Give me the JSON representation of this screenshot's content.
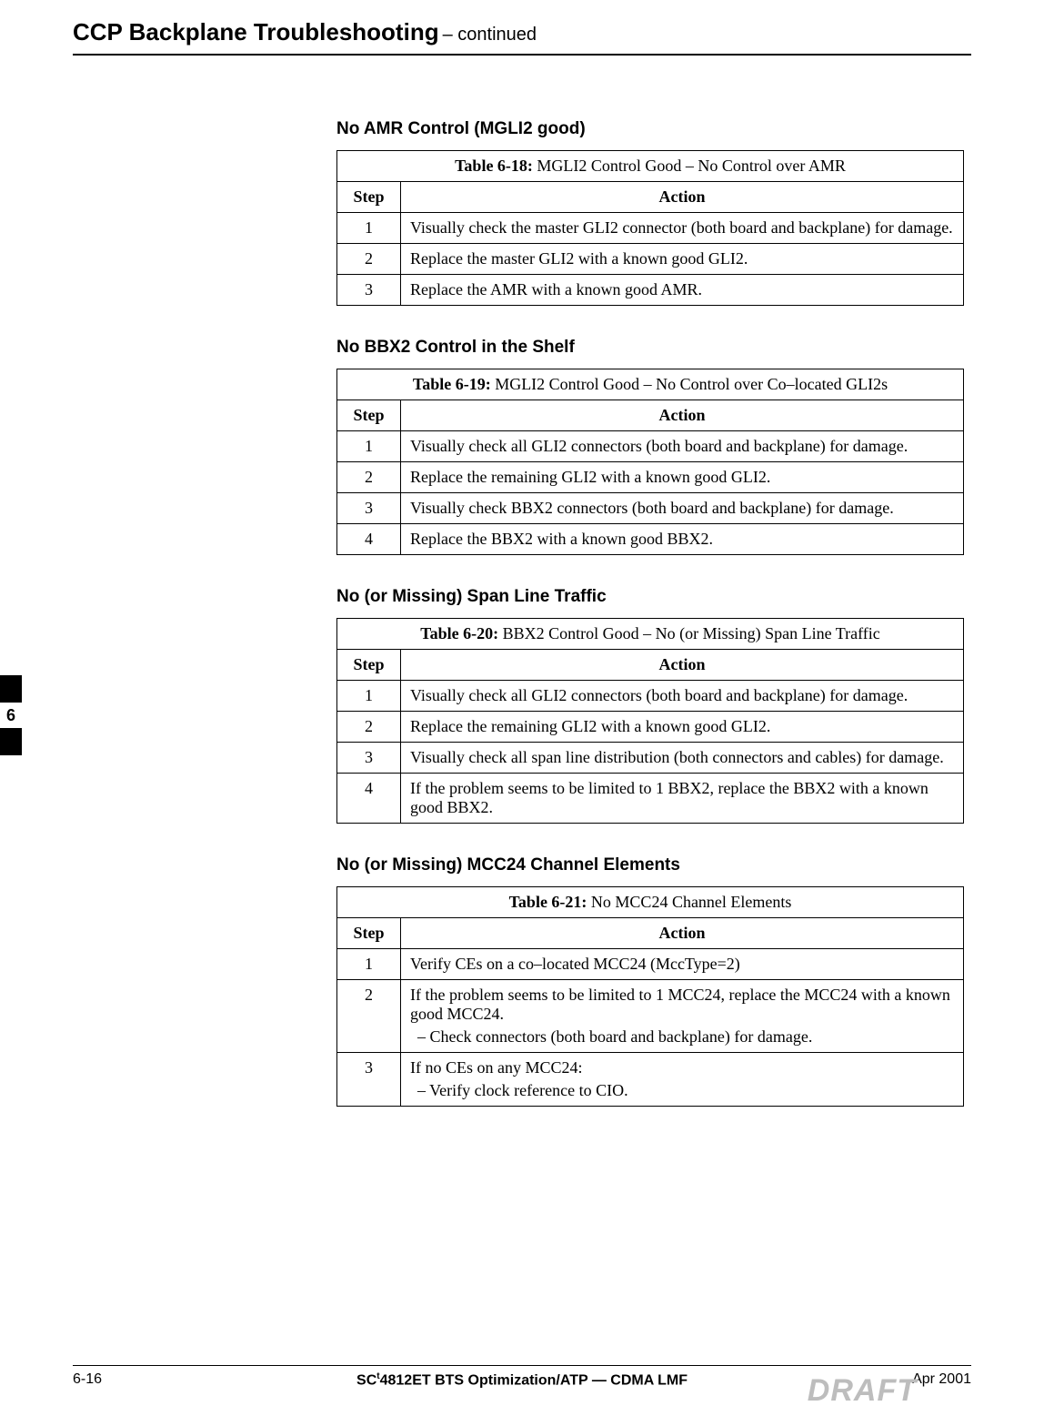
{
  "header": {
    "title": "CCP  Backplane Troubleshooting",
    "continued": " – continued"
  },
  "sideTab": "6",
  "sections": [
    {
      "heading": "No AMR Control (MGLI2 good)",
      "tableLabel": "Table 6-18:",
      "tableTitle": " MGLI2 Control Good – No Control over AMR",
      "stepHeader": "Step",
      "actionHeader": "Action",
      "rows": [
        {
          "step": "1",
          "action": "Visually check the master GLI2 connector (both board and backplane) for damage."
        },
        {
          "step": "2",
          "action": "Replace the master GLI2 with a known good GLI2."
        },
        {
          "step": "3",
          "action": "Replace the AMR with a known good AMR."
        }
      ]
    },
    {
      "heading": "No BBX2 Control in the Shelf",
      "tableLabel": "Table 6-19:",
      "tableTitle": " MGLI2 Control Good – No Control over Co–located GLI2s",
      "stepHeader": "Step",
      "actionHeader": "Action",
      "rows": [
        {
          "step": "1",
          "action": "Visually check all GLI2 connectors (both board and backplane) for damage."
        },
        {
          "step": "2",
          "action": "Replace the remaining GLI2 with a known good GLI2."
        },
        {
          "step": "3",
          "action": "Visually check BBX2 connectors (both board and backplane) for damage."
        },
        {
          "step": "4",
          "action": "Replace the BBX2 with a known good BBX2."
        }
      ]
    },
    {
      "heading": "No (or Missing) Span Line Traffic",
      "tableLabel": "Table 6-20:",
      "tableTitle": " BBX2 Control Good – No (or Missing) Span Line Traffic",
      "stepHeader": "Step",
      "actionHeader": "Action",
      "rows": [
        {
          "step": "1",
          "action": "Visually check all GLI2 connectors (both board and backplane) for damage."
        },
        {
          "step": "2",
          "action": "Replace the remaining GLI2 with a known good GLI2."
        },
        {
          "step": "3",
          "action": "Visually check all span line distribution (both connectors and cables) for damage."
        },
        {
          "step": "4",
          "action": "If the problem seems to be limited to 1 BBX2, replace the BBX2 with a known good BBX2."
        }
      ]
    },
    {
      "heading": "No (or Missing) MCC24 Channel Elements",
      "tableLabel": "Table 6-21:",
      "tableTitle": " No MCC24 Channel Elements",
      "stepHeader": "Step",
      "actionHeader": "Action",
      "rows": [
        {
          "step": "1",
          "action": "Verify CEs on a co–located MCC24 (MccType=2)"
        },
        {
          "step": "2",
          "action": "If the problem seems to be limited to 1 MCC24, replace the MCC24 with a known good MCC24.",
          "sub": "–  Check connectors (both board and backplane) for damage."
        },
        {
          "step": "3",
          "action": "If no CEs on any MCC24:",
          "sub": "–  Verify clock reference to CIO."
        }
      ]
    }
  ],
  "footer": {
    "pageNum": "6-16",
    "centerPre": "SC",
    "tm": "t",
    "centerPost": "4812ET BTS Optimization/ATP — CDMA LMF",
    "date": "Apr 2001",
    "watermark": "DRAFT"
  }
}
